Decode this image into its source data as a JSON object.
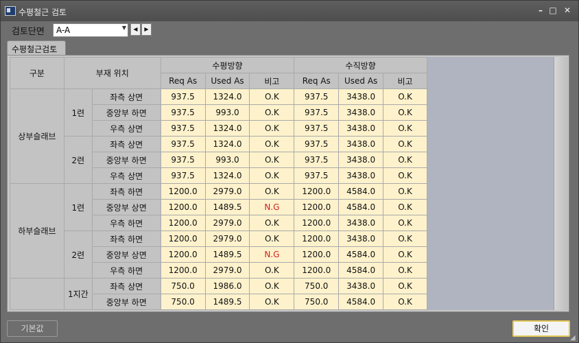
{
  "window": {
    "title": "수평철근 검토"
  },
  "toolbar": {
    "section_label": "검토단면",
    "section_value": "A-A"
  },
  "tabs": [
    {
      "label": "수평철근검토"
    }
  ],
  "table": {
    "header": {
      "group": "구분",
      "member": "부재 위치",
      "horizontal": "수평방향",
      "vertical": "수직방향",
      "req": "Req As",
      "used": "Used As",
      "remark": "비고"
    },
    "groups": [
      {
        "name": "상부슬래브",
        "subs": [
          {
            "name": "1련",
            "rows": [
              [
                "좌측 상면",
                "937.5",
                "1324.0",
                "O.K",
                "937.5",
                "3438.0",
                "O.K"
              ],
              [
                "중앙부 하면",
                "937.5",
                "993.0",
                "O.K",
                "937.5",
                "3438.0",
                "O.K"
              ],
              [
                "우측 상면",
                "937.5",
                "1324.0",
                "O.K",
                "937.5",
                "3438.0",
                "O.K"
              ]
            ]
          },
          {
            "name": "2련",
            "rows": [
              [
                "좌측 상면",
                "937.5",
                "1324.0",
                "O.K",
                "937.5",
                "3438.0",
                "O.K"
              ],
              [
                "중앙부 하면",
                "937.5",
                "993.0",
                "O.K",
                "937.5",
                "3438.0",
                "O.K"
              ],
              [
                "우측 상면",
                "937.5",
                "1324.0",
                "O.K",
                "937.5",
                "3438.0",
                "O.K"
              ]
            ]
          }
        ]
      },
      {
        "name": "하부슬래브",
        "subs": [
          {
            "name": "1련",
            "rows": [
              [
                "좌측 하면",
                "1200.0",
                "2979.0",
                "O.K",
                "1200.0",
                "4584.0",
                "O.K"
              ],
              [
                "중앙부 상면",
                "1200.0",
                "1489.5",
                "N.G",
                "1200.0",
                "4584.0",
                "O.K"
              ],
              [
                "우측 하면",
                "1200.0",
                "2979.0",
                "O.K",
                "1200.0",
                "3438.0",
                "O.K"
              ]
            ]
          },
          {
            "name": "2련",
            "rows": [
              [
                "좌측 하면",
                "1200.0",
                "2979.0",
                "O.K",
                "1200.0",
                "3438.0",
                "O.K"
              ],
              [
                "중앙부 상면",
                "1200.0",
                "1489.5",
                "N.G",
                "1200.0",
                "4584.0",
                "O.K"
              ],
              [
                "우측 하면",
                "1200.0",
                "2979.0",
                "O.K",
                "1200.0",
                "4584.0",
                "O.K"
              ]
            ]
          }
        ]
      },
      {
        "name": "",
        "subs": [
          {
            "name": "1지간",
            "rows": [
              [
                "좌측 상면",
                "750.0",
                "1986.0",
                "O.K",
                "750.0",
                "3438.0",
                "O.K"
              ],
              [
                "중앙부 하면",
                "750.0",
                "1489.5",
                "O.K",
                "750.0",
                "4584.0",
                "O.K"
              ]
            ]
          }
        ]
      }
    ]
  },
  "buttons": {
    "default": "기본값",
    "ok": "확인"
  },
  "colors": {
    "ng_text": "#d22020",
    "cell_bg": "#fef2cc",
    "header_bg": "#c3c3c3",
    "ok_border": "#e6c95a"
  }
}
